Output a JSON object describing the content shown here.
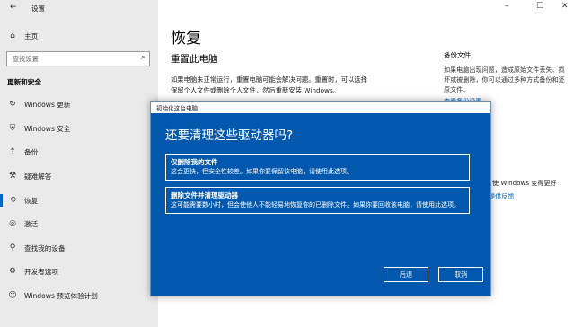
{
  "window": {
    "title": "设置",
    "back_icon": "back-arrow-icon"
  },
  "window_controls": {
    "minimize": "–",
    "maximize": "☐",
    "close": "✕"
  },
  "sidebar": {
    "home": {
      "icon": "home-icon",
      "glyph": "⌂",
      "label": "主页"
    },
    "search": {
      "placeholder": "查找设置",
      "icon": "search-icon",
      "glyph": "⌕"
    },
    "section": "更新和安全",
    "items": [
      {
        "icon": "windows-update-icon",
        "glyph": "↻",
        "label": "Windows 更新"
      },
      {
        "icon": "shield-icon",
        "glyph": "⛨",
        "label": "Windows 安全"
      },
      {
        "icon": "backup-icon",
        "glyph": "⇡",
        "label": "备份"
      },
      {
        "icon": "wrench-icon",
        "glyph": "⚒",
        "label": "疑难解答"
      },
      {
        "icon": "recovery-icon",
        "glyph": "⟲",
        "label": "恢复",
        "selected": true
      },
      {
        "icon": "activation-icon",
        "glyph": "◎",
        "label": "激活"
      },
      {
        "icon": "find-device-icon",
        "glyph": "⚲",
        "label": "查找我的设备"
      },
      {
        "icon": "developer-icon",
        "glyph": "⚙",
        "label": "开发者选项"
      },
      {
        "icon": "windows-insider-icon",
        "glyph": "☺",
        "label": "Windows 预览体验计划"
      }
    ]
  },
  "main": {
    "title": "恢复",
    "section_title": "重置此电脑",
    "description": "如果电脑未正常运行，重置电脑可能会解决问题。重置时，可以选择保留个人文件或删除个人文件，然后重新安装 Windows。"
  },
  "right": {
    "heading": "备份文件",
    "body": "如果电脑出现问题，造成原始文件丢失、损坏或被删除，你可以通过多种方式备份和还原文件。",
    "link": "查看备份设置",
    "frag1": "使 Windows 变得更好",
    "frag2": "提供反馈"
  },
  "dialog": {
    "titlebar": "初始化这台电脑",
    "heading": "还要清理这些驱动器吗?",
    "options": [
      {
        "title": "仅删除我的文件",
        "desc": "这会更快，但安全性较差。如果你要保留该电脑，请使用此选项。"
      },
      {
        "title": "删除文件并清理驱动器",
        "desc": "这可能需要数小时，但会使他人不能轻易地恢复你的已删除文件。如果你要回收该电脑，请使用此选项。"
      }
    ],
    "back_label": "后退",
    "cancel_label": "取消"
  },
  "colors": {
    "dialog_bg": "#0158ac",
    "accent": "#0067c0",
    "sidebar_bg": "#eaeaea"
  }
}
